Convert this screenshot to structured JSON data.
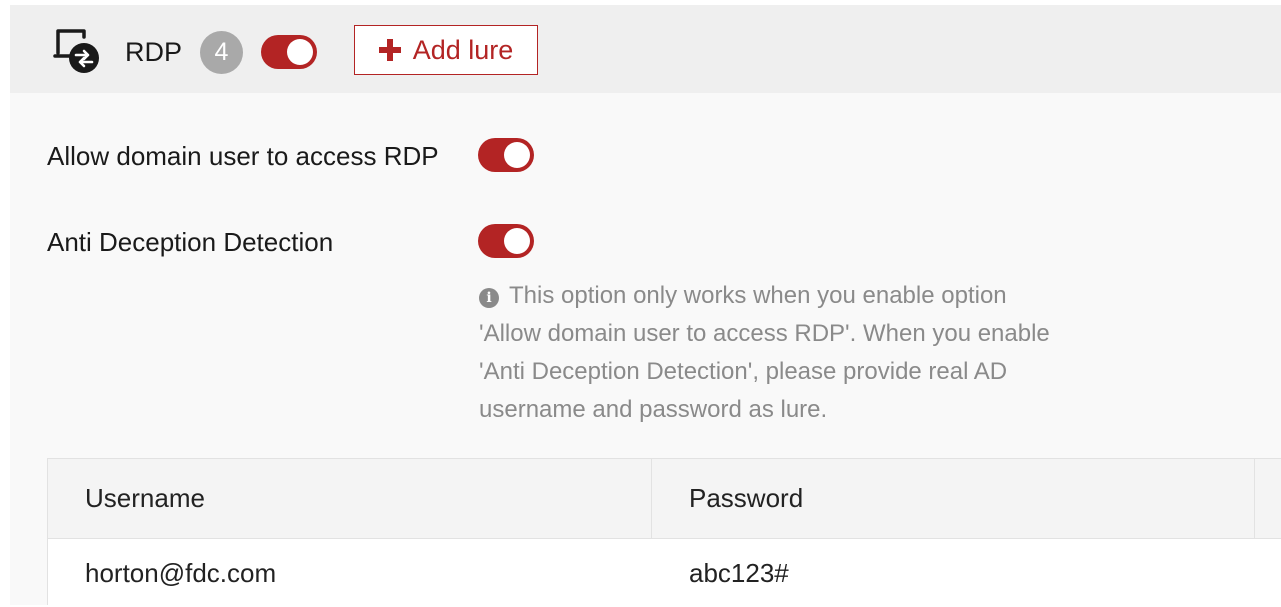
{
  "header": {
    "icon": "remote-desktop-icon",
    "service_label": "RDP",
    "lure_count": "4",
    "service_enabled": true,
    "add_lure_label": "Add lure",
    "add_lure_icon": "plus-icon"
  },
  "settings": {
    "allow_domain_user": {
      "label": "Allow domain user to access RDP",
      "enabled": true
    },
    "anti_deception": {
      "label": "Anti Deception Detection",
      "enabled": true,
      "help_icon": "info-icon",
      "help_lines": [
        "This option only works when you enable option",
        "'Allow domain user to access RDP'. When you enable",
        "'Anti Deception Detection', please provide real AD",
        "username and password as lure."
      ]
    }
  },
  "lures_table": {
    "columns": [
      "Username",
      "Password"
    ],
    "rows": [
      {
        "username": "horton@fdc.com",
        "password": "abc123#"
      }
    ]
  },
  "colors": {
    "accent": "#b32424",
    "badge": "#a9a9a9",
    "help_text": "#8a8a8a",
    "header_bg": "#efefef"
  }
}
